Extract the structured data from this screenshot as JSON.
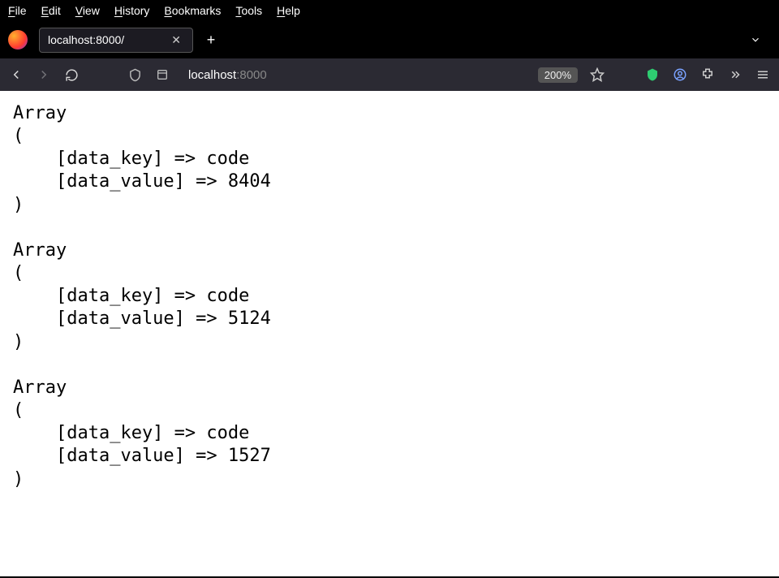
{
  "menu": {
    "file": "File",
    "edit": "Edit",
    "view": "View",
    "history": "History",
    "bookmarks": "Bookmarks",
    "tools": "Tools",
    "help": "Help"
  },
  "tab": {
    "title": "localhost:8000/"
  },
  "url": {
    "host": "localhost",
    "port": ":8000"
  },
  "zoom": "200%",
  "arrays": [
    {
      "data_key": "code",
      "data_value": "8404"
    },
    {
      "data_key": "code",
      "data_value": "5124"
    },
    {
      "data_key": "code",
      "data_value": "1527"
    }
  ]
}
